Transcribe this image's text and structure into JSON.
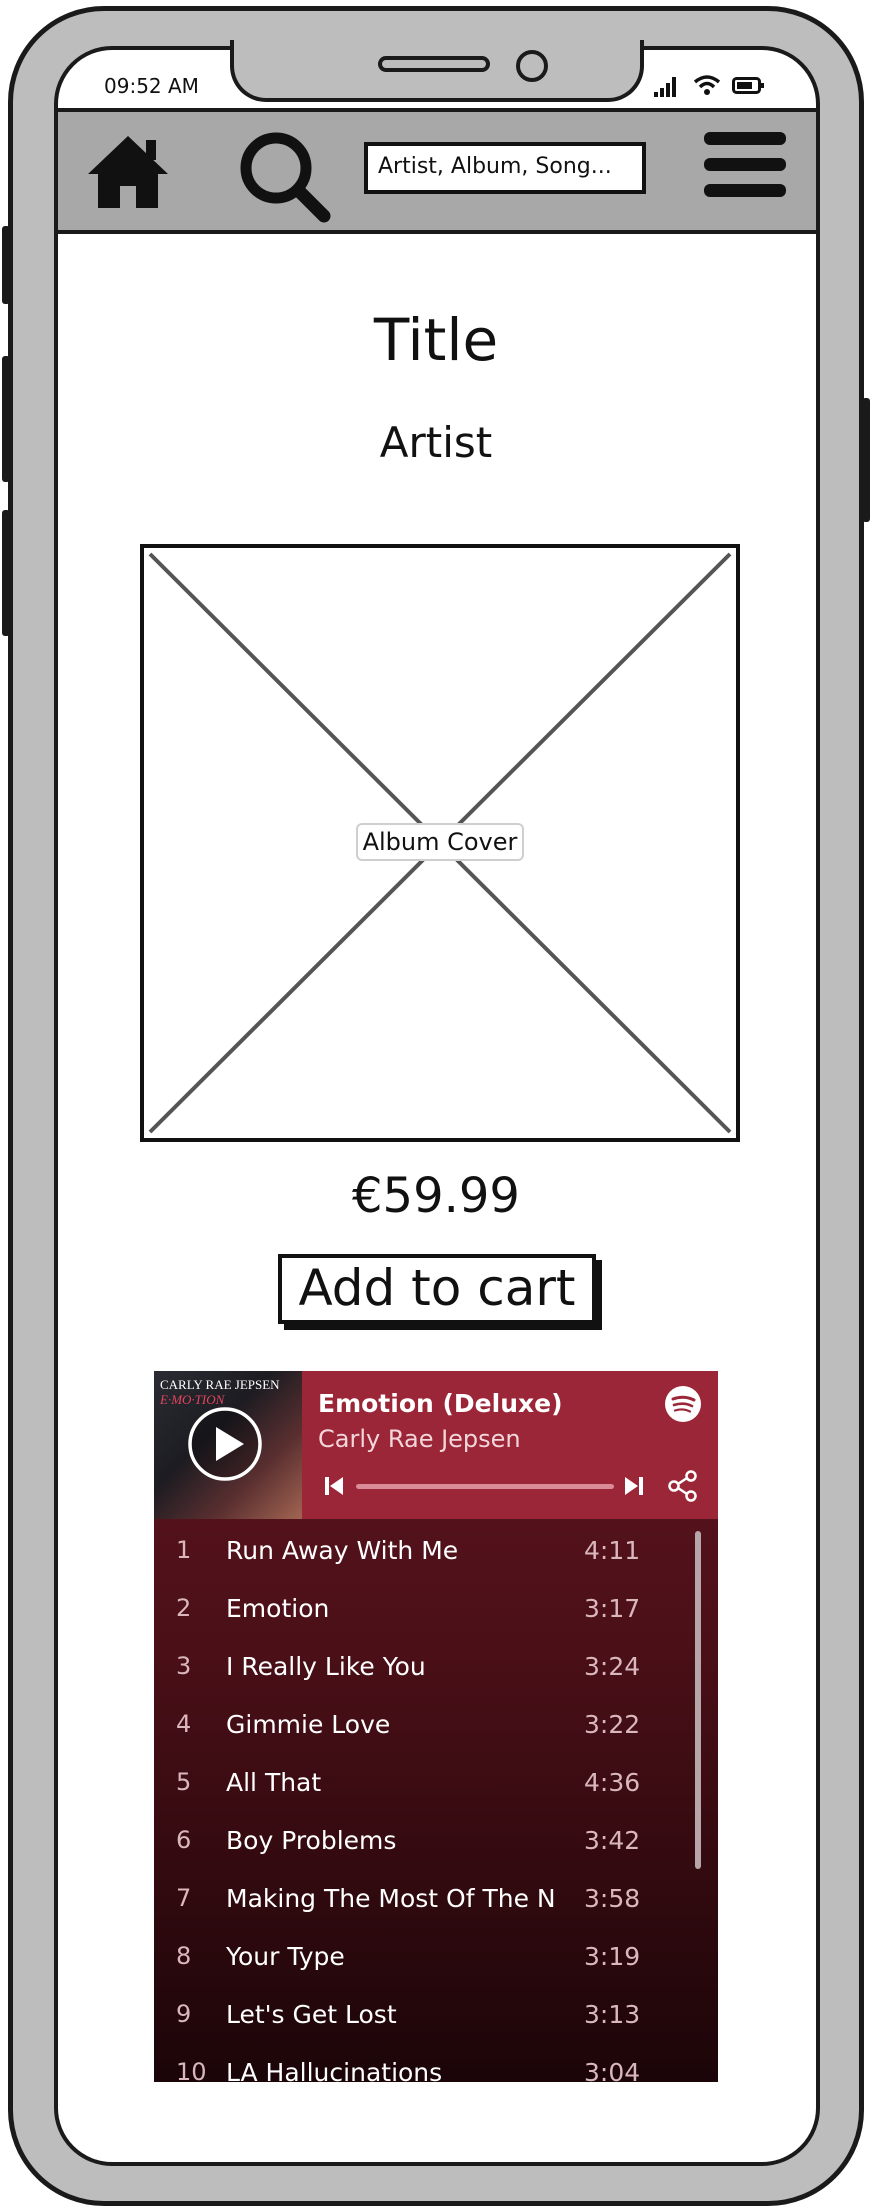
{
  "status_bar": {
    "time": "09:52 AM"
  },
  "navbar": {
    "icons": [
      "home-icon",
      "search-icon",
      "menu-icon"
    ],
    "search_placeholder": "Artist, Album, Song..."
  },
  "product": {
    "title": "Title",
    "artist": "Artist",
    "cover_label": "Album Cover",
    "price": "€59.99",
    "add_to_cart_label": "Add to cart"
  },
  "player": {
    "album_name": "Emotion (Deluxe)",
    "artist_name": "Carly Rae Jepsen",
    "art_text_line1": "CARLY RAE JEPSEN",
    "art_text_line2": "E·MO·TION",
    "accent_color": "#9b2638",
    "tracks": [
      {
        "num": "1",
        "title": "Run Away With Me",
        "duration": "4:11"
      },
      {
        "num": "2",
        "title": "Emotion",
        "duration": "3:17"
      },
      {
        "num": "3",
        "title": "I Really Like You",
        "duration": "3:24"
      },
      {
        "num": "4",
        "title": "Gimmie Love",
        "duration": "3:22"
      },
      {
        "num": "5",
        "title": "All That",
        "duration": "4:36"
      },
      {
        "num": "6",
        "title": "Boy Problems",
        "duration": "3:42"
      },
      {
        "num": "7",
        "title": "Making The Most Of The Ni...",
        "duration": "3:58"
      },
      {
        "num": "8",
        "title": "Your Type",
        "duration": "3:19"
      },
      {
        "num": "9",
        "title": "Let's Get Lost",
        "duration": "3:13"
      },
      {
        "num": "10",
        "title": "LA Hallucinations",
        "duration": "3:04"
      }
    ]
  }
}
